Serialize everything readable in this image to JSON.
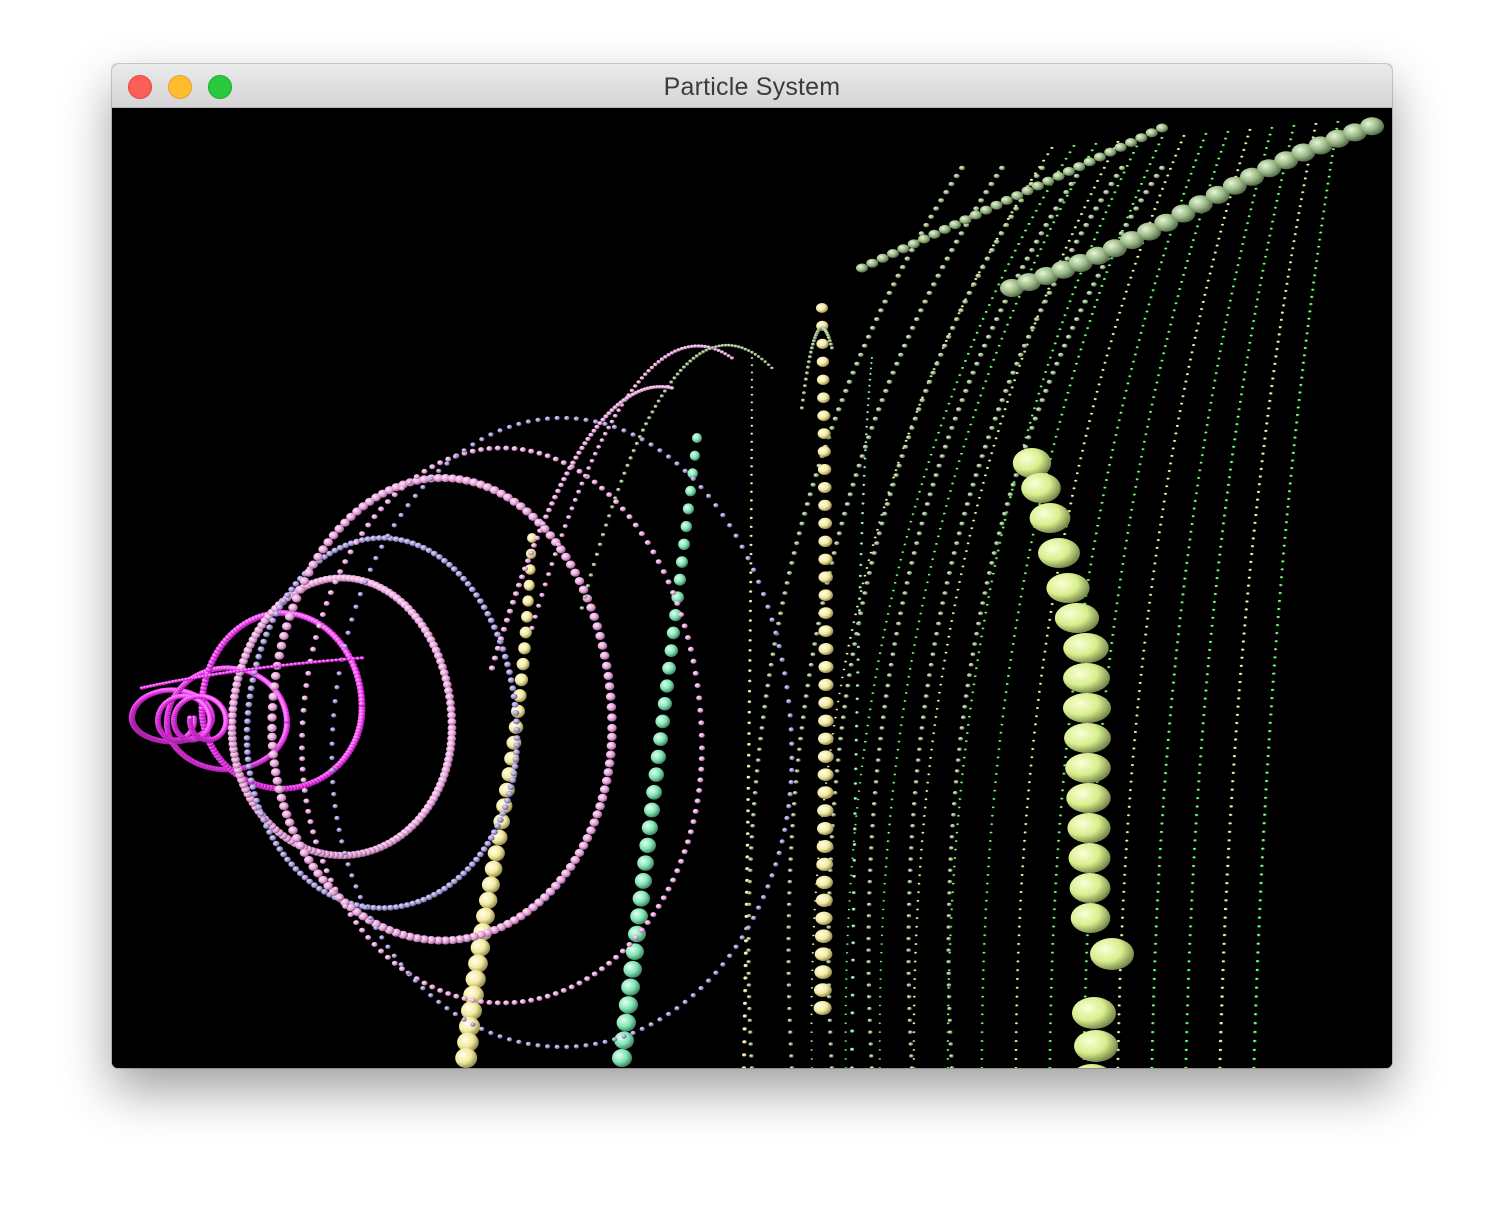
{
  "window": {
    "title": "Particle System",
    "controls": {
      "close": "close-icon",
      "minimize": "minimize-icon",
      "zoom": "zoom-icon"
    }
  },
  "scene": {
    "background": "#000000",
    "colors": {
      "magenta": "#ff22ff",
      "pink": "#f2b0e6",
      "lavender": "#a69ad8",
      "mint": "#7fe6b4",
      "cream": "#f6f0a8",
      "sage": "#9ab887",
      "lime": "#d8ee8c",
      "green": "#44ee44"
    }
  }
}
